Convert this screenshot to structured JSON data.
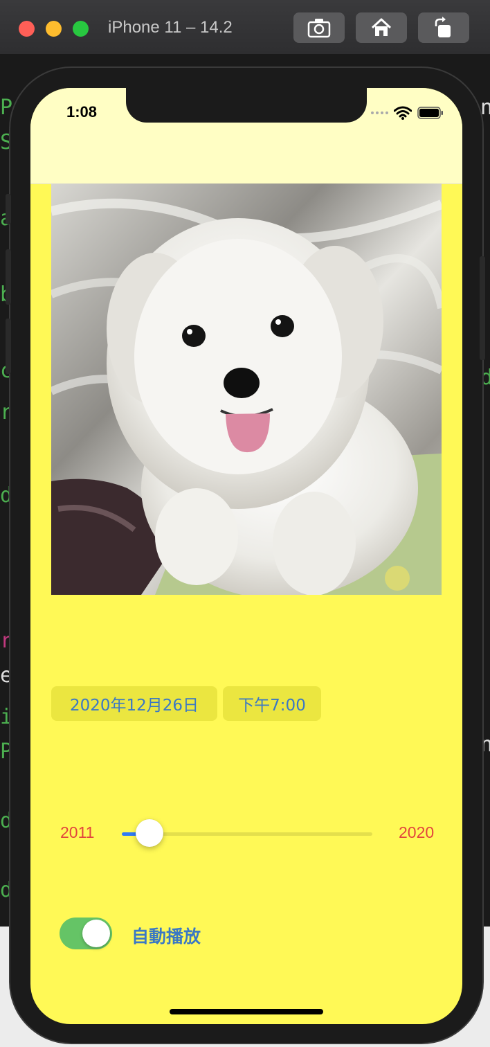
{
  "window": {
    "title": "iPhone 11 – 14.2",
    "toolbar": [
      {
        "icon": "screenshot-icon"
      },
      {
        "icon": "home-icon"
      },
      {
        "icon": "rotate-icon"
      }
    ]
  },
  "status_bar": {
    "time": "1:08",
    "icons": [
      "signal-dots-icon",
      "wifi-icon",
      "battery-icon"
    ]
  },
  "photo": {
    "description_icon": "dog-photo"
  },
  "date_picker": {
    "date": "2020年12月26日",
    "time": "下午7:00"
  },
  "slider": {
    "min_label": "2011",
    "max_label": "2020",
    "value_fraction": 0.1
  },
  "autoplay": {
    "label": "自動播放",
    "on": true
  },
  "colors": {
    "background": "#fff956",
    "navbar": "#fffec4",
    "accent_blue": "#3b78c4",
    "slider_label_red": "#e2453c",
    "toggle_green": "#65c466",
    "slider_fill": "#2f7bf5"
  }
}
